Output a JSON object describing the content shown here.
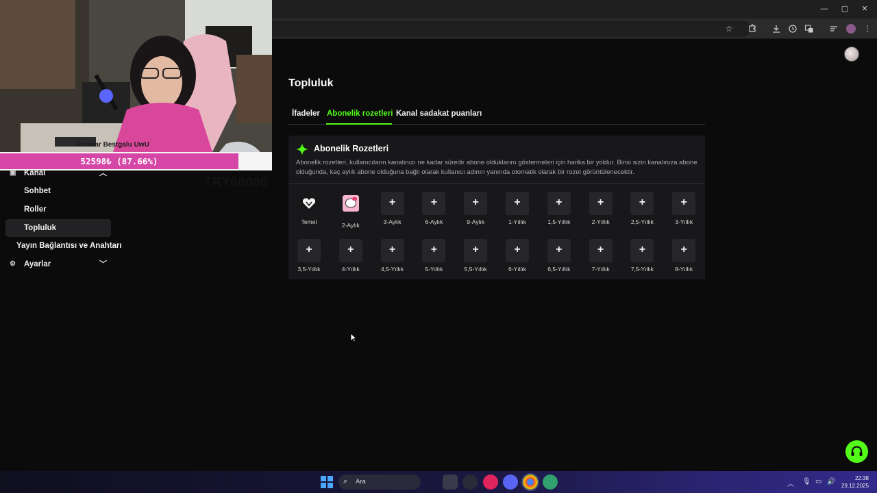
{
  "browser": {
    "window_controls": [
      "—",
      "▢",
      "✕"
    ]
  },
  "sidebar": {
    "items": [
      {
        "label": "Kanal",
        "expanded": true,
        "icon": "channel-icon"
      },
      {
        "label": "Sohbet"
      },
      {
        "label": "Roller"
      },
      {
        "label": "Topluluk",
        "active": true
      },
      {
        "label": "Yayın Bağlantısı ve Anahtarı"
      },
      {
        "label": "Ayarlar",
        "expanded": false,
        "icon": "gear-icon"
      }
    ]
  },
  "page": {
    "title": "Topluluk",
    "tabs": [
      "İfadeler",
      "Abonelik rozetleri",
      "Kanal sadakat puanları"
    ],
    "active_tab": "Abonelik rozetleri",
    "accent_color": "#53fc18"
  },
  "card": {
    "title": "Abonelik Rozetleri",
    "description": "Abonelik rozetleri, kullanıcıların kanalınızı ne kadar süredir abone olduklarını göstermeleri için harika bir yoldur. Birisi sizin kanalınıza abone olduğunda, kaç aylık abone olduğuna bağlı olarak kullanıcı adının yanında otomatik olarak bir rozet görüntülenecektir.",
    "badges": [
      {
        "label": "Temel",
        "state": "image",
        "icon": "heart-badge-icon"
      },
      {
        "label": "2-Aylık",
        "state": "image",
        "icon": "hello-kitty-badge-icon"
      },
      {
        "label": "3-Aylık",
        "state": "add"
      },
      {
        "label": "6-Aylık",
        "state": "add"
      },
      {
        "label": "9-Aylık",
        "state": "add"
      },
      {
        "label": "1-Yıllık",
        "state": "add"
      },
      {
        "label": "1,5-Yıllık",
        "state": "add"
      },
      {
        "label": "2-Yıllık",
        "state": "add"
      },
      {
        "label": "2,5-Yıllık",
        "state": "add"
      },
      {
        "label": "3-Yıllık",
        "state": "add"
      },
      {
        "label": "3,5-Yıllık",
        "state": "add"
      },
      {
        "label": "4-Yıllık",
        "state": "add"
      },
      {
        "label": "4,5-Yıllık",
        "state": "add"
      },
      {
        "label": "5-Yıllık",
        "state": "add"
      },
      {
        "label": "5,5-Yıllık",
        "state": "add"
      },
      {
        "label": "6-Yıllık",
        "state": "add"
      },
      {
        "label": "6,5-Yıllık",
        "state": "add"
      },
      {
        "label": "7-Yıllık",
        "state": "add"
      },
      {
        "label": "7,5-Yıllık",
        "state": "add"
      },
      {
        "label": "8-Yıllık",
        "state": "add"
      }
    ],
    "add_glyph": "+"
  },
  "overlay": {
    "donation_text": "52598₺ (87.66%)",
    "donation_percent": 87.66,
    "ghost_text": "TRY60000",
    "caption": "Geomar Bestgalu UwU"
  },
  "taskbar": {
    "search_placeholder": "Ara",
    "time": "22:38",
    "date": "29.12.2025"
  }
}
